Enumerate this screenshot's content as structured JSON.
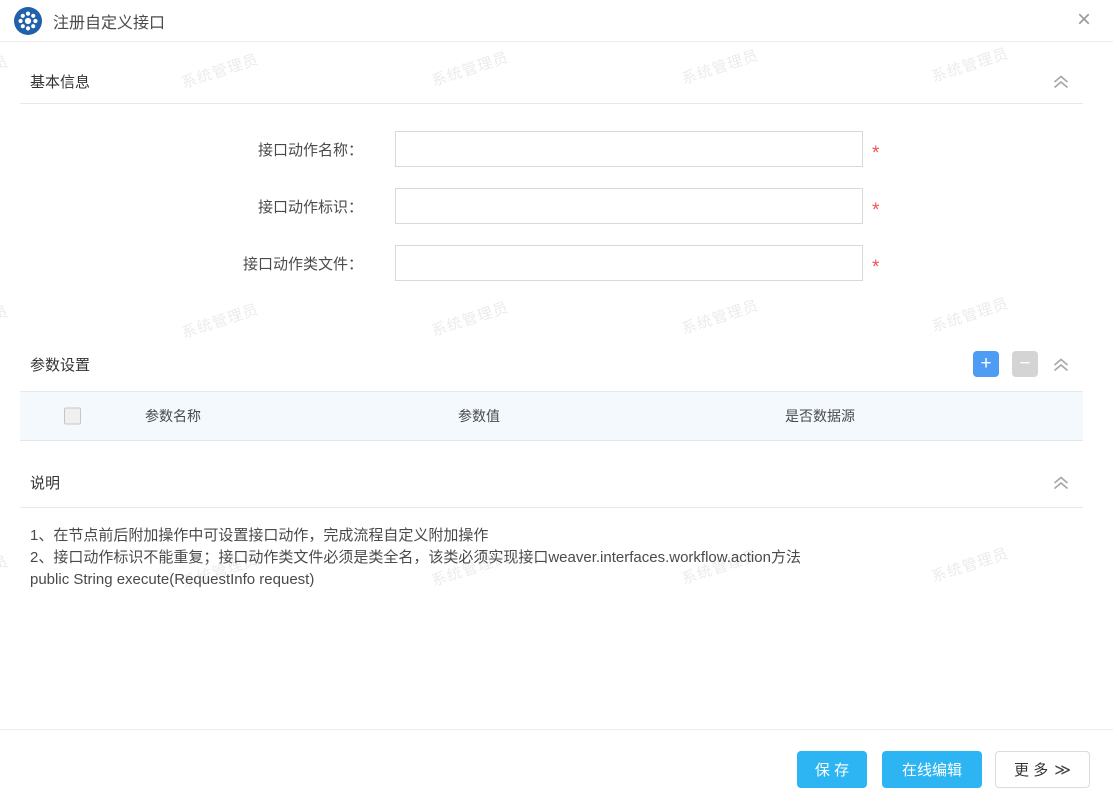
{
  "header": {
    "title": "注册自定义接口",
    "close_icon": "×"
  },
  "watermark": {
    "text": "系统管理员"
  },
  "basic_info": {
    "title": "基本信息",
    "fields": [
      {
        "label": "接口动作名称：",
        "value": "",
        "required_mark": "*"
      },
      {
        "label": "接口动作标识：",
        "value": "",
        "required_mark": "*"
      },
      {
        "label": "接口动作类文件：",
        "value": "",
        "required_mark": "*"
      }
    ]
  },
  "params": {
    "title": "参数设置",
    "add_label": "+",
    "remove_label": "−",
    "columns": [
      "参数名称",
      "参数值",
      "是否数据源"
    ],
    "rows": []
  },
  "notes": {
    "title": "说明",
    "lines": [
      "1、在节点前后附加操作中可设置接口动作，完成流程自定义附加操作",
      "2、接口动作标识不能重复；接口动作类文件必须是类全名，该类必须实现接口weaver.interfaces.workflow.action方法public String execute(RequestInfo request)"
    ]
  },
  "footer": {
    "save_label": "保 存",
    "online_edit_label": "在线编辑",
    "more_label": "更 多",
    "more_icon": "≫"
  },
  "colors": {
    "primary_button": "#2cb5f2",
    "add_button": "#4f9cf4",
    "remove_button": "#d4d4d4",
    "required": "#f15353",
    "badge_circle": "#2161aa",
    "table_header_bg": "#f4f9fd",
    "watermark_text": "rgba(90,90,90,0.12)"
  }
}
